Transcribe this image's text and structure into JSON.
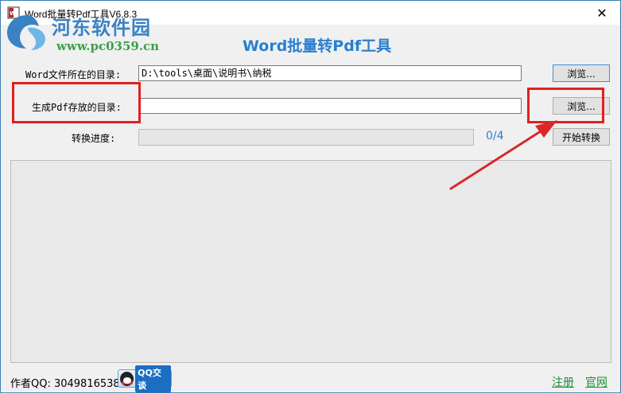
{
  "window": {
    "title": "Word批量转Pdf工具V6.8.3",
    "close_glyph": "✕"
  },
  "watermark": {
    "title": "河东软件园",
    "url": "www.pc0359.cn"
  },
  "heading": "Word批量转Pdf工具",
  "form": {
    "word_dir_label": "Word文件所在的目录:",
    "word_dir_value": "D:\\tools\\桌面\\说明书\\纳税",
    "pdf_dir_label": "生成Pdf存放的目录:",
    "pdf_dir_value": "",
    "browse_label_1": "浏览...",
    "browse_label_2": "浏览...",
    "progress_label": "转换进度:",
    "progress_fraction": 0,
    "progress_count": "0/4",
    "start_button_label": "开始转换"
  },
  "footer": {
    "author": "作者QQ: 3049816538",
    "qq_button_label": "QQ交谈",
    "register_link": "注册",
    "website_link": "官网"
  },
  "colors": {
    "heading_blue": "#2a7fd0",
    "highlight_red": "#e02020",
    "link_green": "#1a8f3a"
  },
  "icons": {
    "app": "word-pdf-app-icon",
    "close": "close-icon",
    "qq": "qq-penguin-icon",
    "watermark_logo": "pc0359-logo-icon"
  }
}
